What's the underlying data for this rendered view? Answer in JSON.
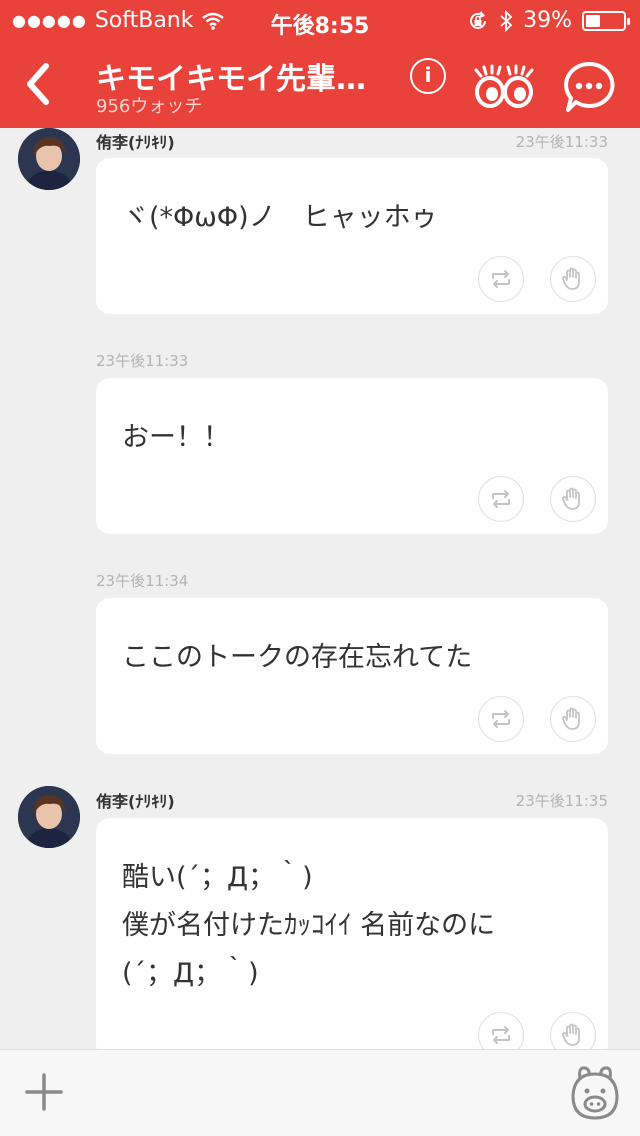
{
  "status_bar": {
    "signal_dots": "●●●●●",
    "carrier": "SoftBank",
    "time": "午後8:55",
    "battery_percent": "39%",
    "battery_level": 0.39
  },
  "nav": {
    "title": "キモイキモイ先輩…",
    "subtitle": "956ウォッチ",
    "info_label": "i"
  },
  "messages": [
    {
      "author": "侑李(ﾅﾘｷﾘ)",
      "timestamp": "23午後11:33",
      "text": "ヾ(*ΦωΦ)ノ　ヒャッホゥ"
    },
    {
      "timestamp": "23午後11:33",
      "text": "おー！！"
    },
    {
      "timestamp": "23午後11:34",
      "text": "ここのトークの存在忘れてた"
    },
    {
      "author": "侑李(ﾅﾘｷﾘ)",
      "timestamp": "23午後11:35",
      "text": "酷い(´；Д；｀)\n僕が名付けたｶｯｺｲｲ 名前なのに\n(´；Д；｀)"
    }
  ],
  "colors": {
    "accent": "#e8423a",
    "background": "#efefef",
    "bubble": "#ffffff"
  },
  "icons": [
    "wifi-icon",
    "lock-rotation-icon",
    "bluetooth-icon",
    "back-icon",
    "info-icon",
    "watch-eyes-icon",
    "chat-menu-icon",
    "repost-icon",
    "like-hand-icon",
    "plus-icon",
    "stamp-icon"
  ]
}
